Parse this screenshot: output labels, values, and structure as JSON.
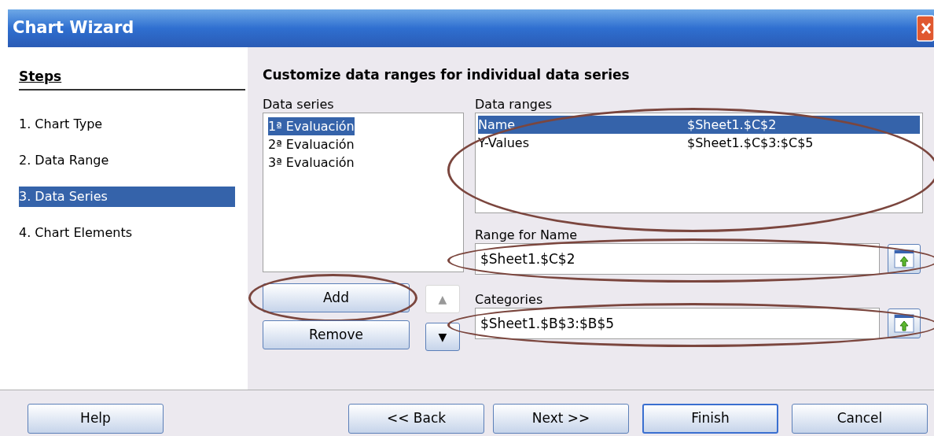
{
  "window": {
    "title": "Chart Wizard"
  },
  "steps": {
    "heading": "Steps",
    "items": [
      {
        "label": "1. Chart Type",
        "selected": false
      },
      {
        "label": "2. Data Range",
        "selected": false
      },
      {
        "label": "3. Data Series",
        "selected": true
      },
      {
        "label": "4. Chart Elements",
        "selected": false
      }
    ]
  },
  "heading": "Customize data ranges for individual data series",
  "data_series": {
    "label": "Data series",
    "items": [
      {
        "label": "1ª Evaluación",
        "selected": true
      },
      {
        "label": "2ª Evaluación",
        "selected": false
      },
      {
        "label": "3ª Evaluación",
        "selected": false
      }
    ]
  },
  "data_ranges": {
    "label": "Data ranges",
    "circled": true,
    "rows": [
      {
        "role": "Name",
        "range": "$Sheet1.$C$2",
        "selected": true
      },
      {
        "role": "Y-Values",
        "range": "$Sheet1.$C$3:$C$5",
        "selected": false
      }
    ]
  },
  "range_for_name": {
    "label": "Range for Name",
    "value": "$Sheet1.$C$2",
    "circled": true
  },
  "categories": {
    "label": "Categories",
    "value": "$Sheet1.$B$3:$B$5",
    "circled": true
  },
  "series_buttons": [
    {
      "label": "Add",
      "circled": true
    },
    {
      "label": "Remove",
      "circled": false
    }
  ],
  "move_buttons": [
    {
      "symbol": "▲",
      "disabled": true
    },
    {
      "symbol": "▼",
      "disabled": false
    }
  ],
  "footer_buttons": [
    {
      "label": "Help",
      "default": false
    },
    {
      "label": "<< Back",
      "default": false
    },
    {
      "label": "Next >>",
      "default": false
    },
    {
      "label": "Finish",
      "default": true
    },
    {
      "label": "Cancel",
      "default": false
    }
  ]
}
